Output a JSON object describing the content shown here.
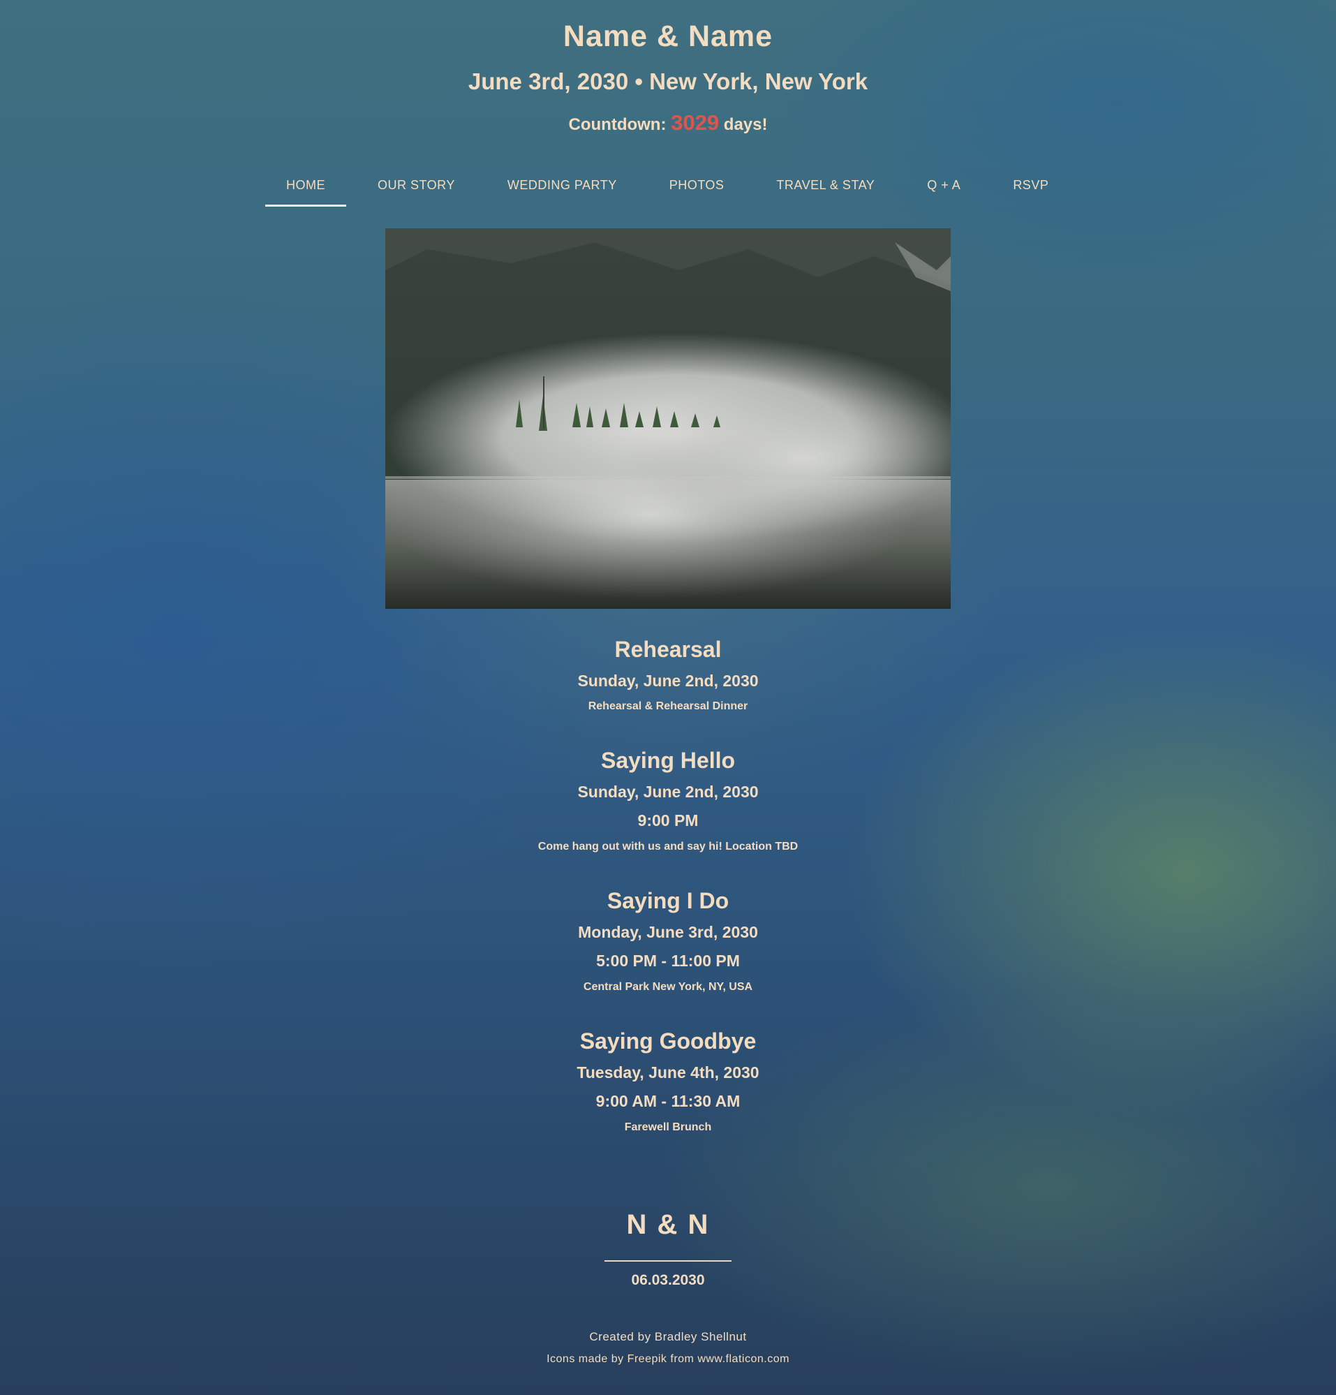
{
  "header": {
    "names": "Name & Name",
    "date_location": "June 3rd, 2030 • New York, New York",
    "countdown_prefix": "Countdown:",
    "countdown_days": "3029",
    "countdown_suffix": "days!"
  },
  "nav": {
    "items": [
      {
        "label": "HOME",
        "active": true
      },
      {
        "label": "OUR STORY"
      },
      {
        "label": "WEDDING PARTY"
      },
      {
        "label": "PHOTOS"
      },
      {
        "label": "TRAVEL & STAY"
      },
      {
        "label": "Q + A"
      },
      {
        "label": "RSVP"
      }
    ]
  },
  "events": [
    {
      "title": "Rehearsal",
      "date": "Sunday, June 2nd, 2030",
      "description": "Rehearsal & Rehearsal Dinner"
    },
    {
      "title": "Saying Hello",
      "date": "Sunday, June 2nd, 2030",
      "time": "9:00 PM",
      "description": "Come hang out with us and say hi! Location TBD"
    },
    {
      "title": "Saying I Do",
      "date": "Monday, June 3rd, 2030",
      "time": "5:00 PM - 11:00 PM",
      "description": "Central Park New York, NY, USA"
    },
    {
      "title": "Saying Goodbye",
      "date": "Tuesday, June 4th, 2030",
      "time": "9:00 AM - 11:30 AM",
      "description": "Farewell Brunch"
    }
  ],
  "footer": {
    "monogram": "N & N",
    "date": "06.03.2030",
    "credit": "Created by Bradley Shellnut",
    "icons_credit": "Icons made by Freepik from www.flaticon.com"
  },
  "colors": {
    "text": "#f4dcc0",
    "countdown_accent": "#e0544c"
  }
}
